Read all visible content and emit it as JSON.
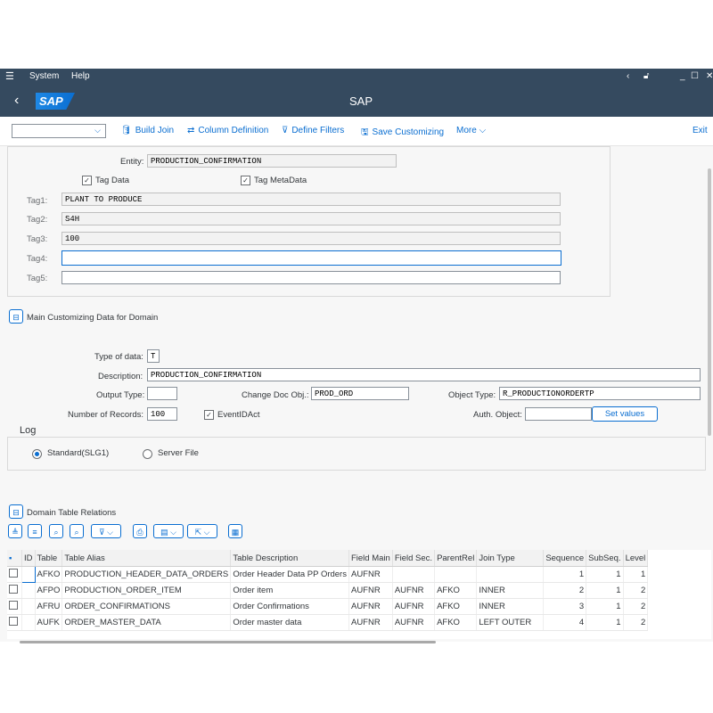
{
  "menubar": {
    "system": "System",
    "help": "Help"
  },
  "shell": {
    "title": "SAP",
    "logo": "SAP"
  },
  "toolbar": {
    "build_join": "Build Join",
    "column_definition": "Column Definition",
    "define_filters": "Define Filters",
    "save_customizing": "Save Customizing",
    "more": "More",
    "exit": "Exit"
  },
  "entity": {
    "label": "Entity:",
    "value": "PRODUCTION_CONFIRMATION",
    "tag_data": "Tag Data",
    "tag_metadata": "Tag MetaData",
    "tags": [
      {
        "label": "Tag1:",
        "value": "PLANT TO PRODUCE"
      },
      {
        "label": "Tag2:",
        "value": "S4H"
      },
      {
        "label": "Tag3:",
        "value": "100"
      },
      {
        "label": "Tag4:",
        "value": ""
      },
      {
        "label": "Tag5:",
        "value": ""
      }
    ]
  },
  "main": {
    "section_title": "Main Customizing Data for Domain",
    "type_label": "Type of data:",
    "type_value": "T",
    "desc_label": "Description:",
    "desc_value": "PRODUCTION_CONFIRMATION",
    "output_label": "Output Type:",
    "output_value": "",
    "changedoc_label": "Change Doc Obj.:",
    "changedoc_value": "PROD_ORD",
    "objtype_label": "Object Type:",
    "objtype_value": "R_PRODUCTIONORDERTP",
    "numrec_label": "Number of Records:",
    "numrec_value": "100",
    "eventid_label": "EventIDAct",
    "auth_label": "Auth. Object:",
    "auth_value": "",
    "setvalues": "Set values"
  },
  "log": {
    "title": "Log",
    "standard": "Standard(SLG1)",
    "server": "Server File"
  },
  "relations": {
    "title": "Domain Table Relations",
    "columns": [
      "ID",
      "Table",
      "Table Alias",
      "Table Description",
      "Field Main",
      "Field Sec.",
      "ParentRel",
      "Join Type",
      "Sequence",
      "SubSeq.",
      "Level"
    ],
    "rows": [
      [
        "",
        "AFKO",
        "PRODUCTION_HEADER_DATA_ORDERS",
        "Order Header Data PP Orders",
        "AUFNR",
        "",
        "",
        "",
        "1",
        "1",
        "1"
      ],
      [
        "",
        "AFPO",
        "PRODUCTION_ORDER_ITEM",
        "Order item",
        "AUFNR",
        "AUFNR",
        "AFKO",
        "INNER",
        "2",
        "1",
        "2"
      ],
      [
        "",
        "AFRU",
        "ORDER_CONFIRMATIONS",
        "Order Confirmations",
        "AUFNR",
        "AUFNR",
        "AFKO",
        "INNER",
        "3",
        "1",
        "2"
      ],
      [
        "",
        "AUFK",
        "ORDER_MASTER_DATA",
        "Order master data",
        "AUFNR",
        "AUFNR",
        "AFKO",
        "LEFT OUTER",
        "4",
        "1",
        "2"
      ]
    ]
  }
}
